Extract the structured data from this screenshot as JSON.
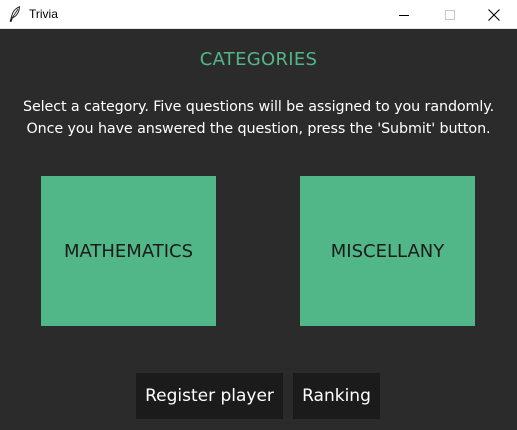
{
  "window": {
    "title": "Trivia",
    "icons": {
      "app": "feather-icon",
      "minimize": "minimize-icon",
      "maximize": "maximize-icon",
      "close": "close-icon"
    }
  },
  "main": {
    "heading": "CATEGORIES",
    "instructions_line1": "Select a category. Five questions will be assigned to you randomly.",
    "instructions_line2": "Once you have answered the question, press the 'Submit' button.",
    "categories": [
      {
        "label": "MATHEMATICS"
      },
      {
        "label": "MISCELLANY"
      }
    ],
    "buttons": {
      "register_label": "Register player",
      "ranking_label": "Ranking"
    }
  },
  "colors": {
    "background": "#2b2b2c",
    "accent": "#52b788",
    "button_dark": "#1b1b1b",
    "text_light": "#ffffff"
  }
}
